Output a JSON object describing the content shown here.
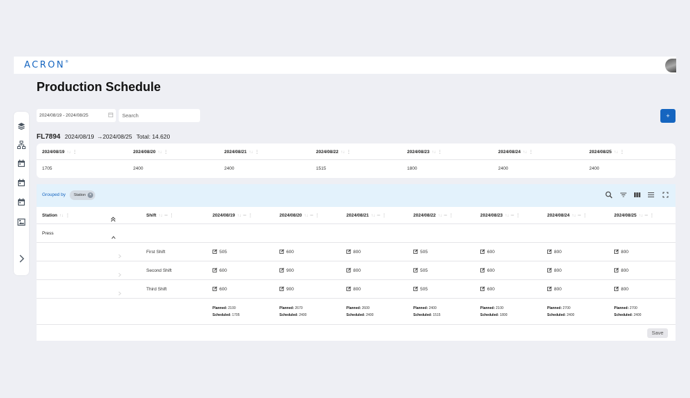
{
  "app": {
    "logo_text": "ACRON",
    "logo_mark": "®",
    "page_title": "Production Schedule"
  },
  "sidebar": {
    "icons": [
      "layers-icon",
      "hierarchy-icon",
      "calendar-icon",
      "calendar-icon",
      "calendar-icon",
      "gallery-icon"
    ],
    "expand_icon": "chevron-right-icon"
  },
  "filters": {
    "date_range": "2024/08/19 - 2024/08/25",
    "search_placeholder": "Search"
  },
  "add_button_label": "+",
  "summary": {
    "code": "FL7894",
    "range_start": "2024/08/19",
    "arrow": "→",
    "range_end": "2024/08/25",
    "total_label": "Total: 14.620"
  },
  "totals_table": {
    "columns": [
      "2024/08/19",
      "2024/08/20",
      "2024/08/21",
      "2024/08/22",
      "2024/08/23",
      "2024/08/24",
      "2024/08/25"
    ],
    "values": [
      "1705",
      "2400",
      "2400",
      "1515",
      "1800",
      "2400",
      "2400"
    ]
  },
  "grouping": {
    "label": "Grouped by",
    "chip": "Station"
  },
  "toolbar_icons": [
    "search-icon",
    "filter-icon",
    "columns-icon",
    "density-icon",
    "fullscreen-icon"
  ],
  "grid": {
    "headers": {
      "station": "Station",
      "shift": "Shift",
      "dates": [
        "2024/08/19",
        "2024/08/20",
        "2024/08/21",
        "2024/08/22",
        "2024/08/23",
        "2024/08/24",
        "2024/08/25"
      ]
    },
    "group_name": "Press",
    "rows": [
      {
        "shift": "First Shift",
        "values": [
          "505",
          "600",
          "800",
          "505",
          "600",
          "800",
          "800"
        ]
      },
      {
        "shift": "Second Shift",
        "values": [
          "600",
          "900",
          "800",
          "505",
          "600",
          "800",
          "800"
        ]
      },
      {
        "shift": "Third Shift",
        "values": [
          "600",
          "900",
          "800",
          "505",
          "600",
          "800",
          "800"
        ]
      }
    ],
    "summary": {
      "planned_label": "Planned:",
      "scheduled_label": "Scheduled:",
      "planned": [
        "2100",
        "2670",
        "2600",
        "2400",
        "2100",
        "2700",
        "2700"
      ],
      "scheduled": [
        "1705",
        "2400",
        "2400",
        "1515",
        "1800",
        "2400",
        "2400"
      ]
    }
  },
  "save_label": "Save",
  "colors": {
    "brand": "#1565c0",
    "background": "#eeeff4",
    "group_bar": "#e3f2fc"
  }
}
